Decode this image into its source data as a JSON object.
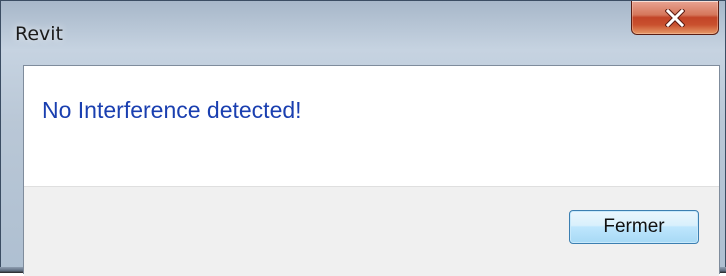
{
  "window": {
    "title": "Revit",
    "close_icon": "close-x-icon"
  },
  "dialog": {
    "message": "No Interference detected!",
    "close_button_label": "Fermer"
  },
  "colors": {
    "message_text": "#1a3fb0",
    "close_button_red": "#c24427",
    "footer_bg": "#f0f0f0"
  }
}
